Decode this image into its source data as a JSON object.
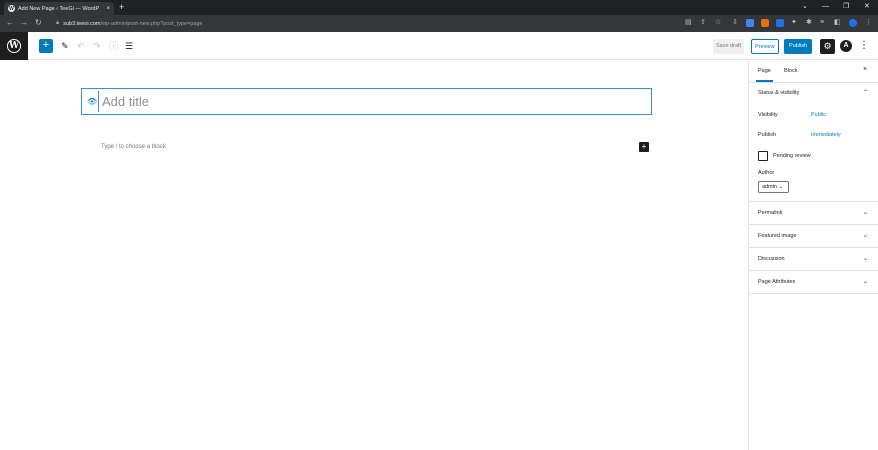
{
  "browser": {
    "tab_title": "Add New Page ‹ TeeGi — WordP",
    "favicon": "W",
    "tab_close": "×",
    "new_tab": "+",
    "url_host": "sub3.teeoi.com",
    "url_path": "/wp-admin/post-new.php?post_type=page",
    "window_controls": [
      "⌄",
      "—",
      "❐",
      "✕"
    ]
  },
  "wp": {
    "logo": "W",
    "add_block": "+",
    "save_draft": "Save draft",
    "preview": "Preview",
    "publish": "Publish",
    "settings_icon": "⚙",
    "avatar": "A",
    "more": "⋮"
  },
  "editor": {
    "title_placeholder": "Add title",
    "block_placeholder": "Type / to choose a block",
    "block_add": "+"
  },
  "sidebar": {
    "tabs": [
      "Page",
      "Block"
    ],
    "close": "×",
    "status_heading": "Status & visibility",
    "visibility_label": "Visibility",
    "visibility_value": "Public",
    "publish_label": "Publish",
    "publish_value": "Immediately",
    "pending_review": "Pending review",
    "author_label": "Author",
    "author_value": "admin ⌄",
    "sections": [
      "Permalink",
      "Featured image",
      "Discussion",
      "Page Attributes"
    ]
  },
  "colors": {
    "accent": "#007cba",
    "chrome_dark": "#202124",
    "wp_dark": "#1e1e1e"
  }
}
